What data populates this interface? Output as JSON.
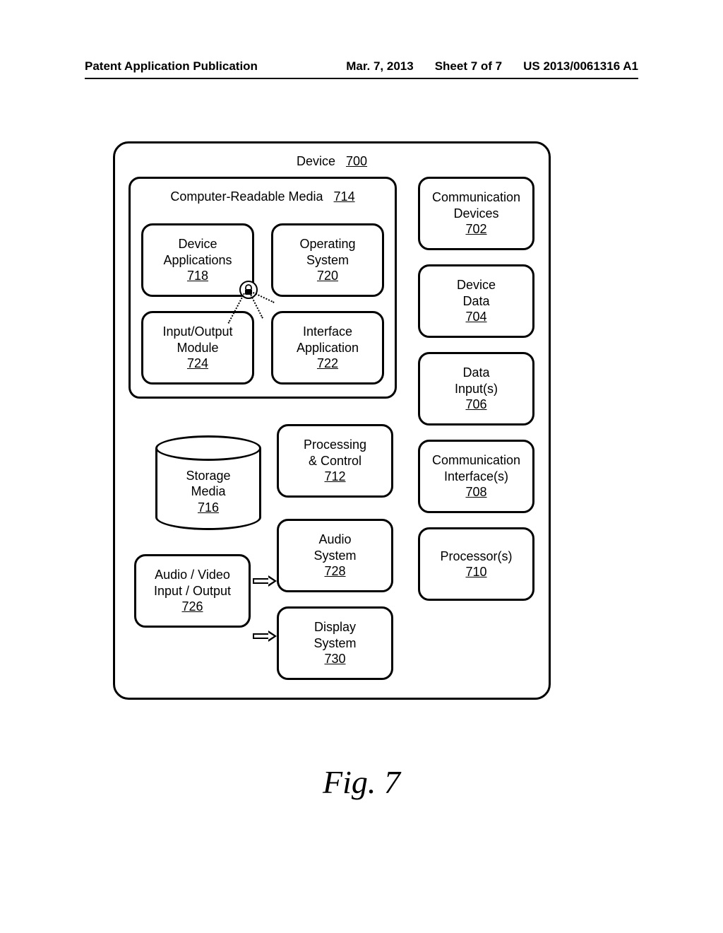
{
  "header": {
    "pub_type": "Patent Application Publication",
    "date": "Mar. 7, 2013",
    "sheet": "Sheet 7 of 7",
    "pub_number": "US 2013/0061316 A1"
  },
  "device": {
    "label": "Device",
    "ref": "700"
  },
  "crm_container": {
    "label": "Computer-Readable Media",
    "ref": "714"
  },
  "blocks": {
    "device_applications": {
      "line1": "Device",
      "line2": "Applications",
      "ref": "718"
    },
    "operating_system": {
      "line1": "Operating",
      "line2": "System",
      "ref": "720"
    },
    "io_module": {
      "line1": "Input/Output",
      "line2": "Module",
      "ref": "724"
    },
    "interface_app": {
      "line1": "Interface",
      "line2": "Application",
      "ref": "722"
    },
    "comm_devices": {
      "line1": "Communication",
      "line2": "Devices",
      "ref": "702"
    },
    "device_data": {
      "line1": "Device",
      "line2": "Data",
      "ref": "704"
    },
    "data_inputs": {
      "line1": "Data",
      "line2": "Input(s)",
      "ref": "706"
    },
    "comm_interfaces": {
      "line1": "Communication",
      "line2": "Interface(s)",
      "ref": "708"
    },
    "processors": {
      "line1": "Processor(s)",
      "line2": "",
      "ref": "710"
    },
    "processing_control": {
      "line1": "Processing",
      "line2": "& Control",
      "ref": "712"
    },
    "storage_media": {
      "line1": "Storage",
      "line2": "Media",
      "ref": "716"
    },
    "audio_system": {
      "line1": "Audio",
      "line2": "System",
      "ref": "728"
    },
    "display_system": {
      "line1": "Display",
      "line2": "System",
      "ref": "730"
    },
    "av_io": {
      "line1": "Audio / Video",
      "line2": "Input / Output",
      "ref": "726"
    }
  },
  "figure_caption": "Fig. 7"
}
